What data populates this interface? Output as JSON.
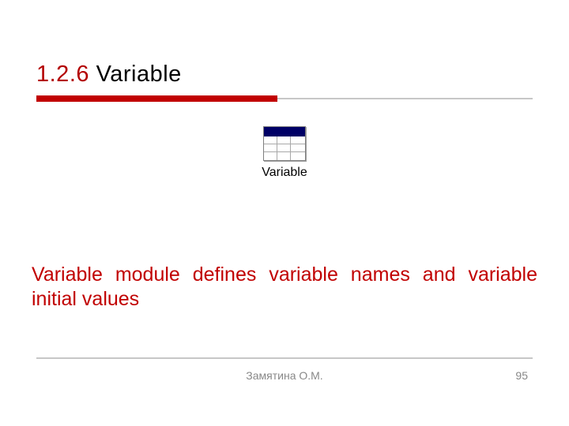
{
  "heading": {
    "section_number": "1.2.6",
    "title": "Variable"
  },
  "module": {
    "icon_name": "variable-table-icon",
    "label": "Variable"
  },
  "body": {
    "text": "Variable module defines variable names and variable initial values"
  },
  "footer": {
    "author": "Замятина О.М.",
    "page": "95"
  },
  "colors": {
    "accent": "#c10000",
    "titlebar": "#000066"
  }
}
